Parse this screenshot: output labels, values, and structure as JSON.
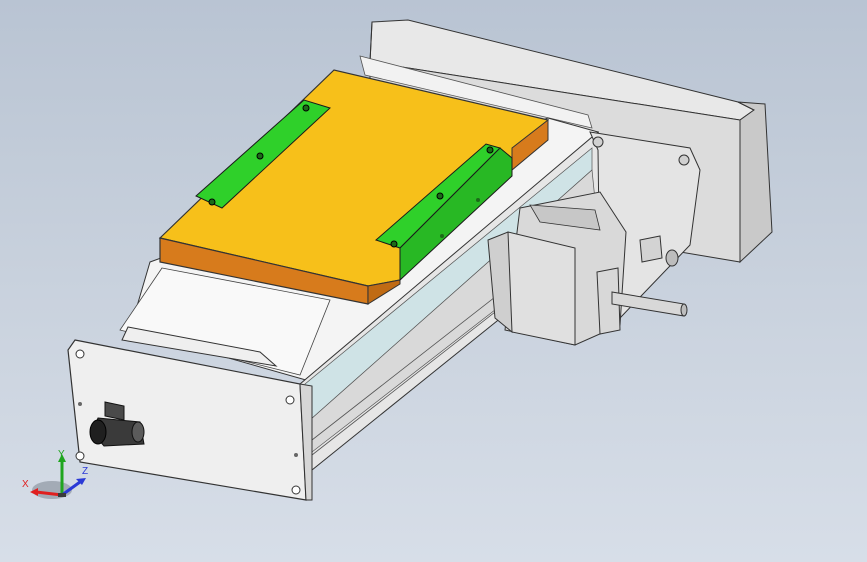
{
  "viewport": {
    "background_top": "#b9c4d3",
    "background_bottom": "#d7dee8"
  },
  "model": {
    "parts": {
      "carriage_plate": "#f7c01a",
      "carriage_plate_side": "#d77b1c",
      "brackets": "#2fd02a",
      "body": "#f1f1f1",
      "motor": "#e2e2e2",
      "fitting": "#3a3a3a"
    }
  },
  "triad": {
    "x_label": "X",
    "y_label": "Y",
    "z_label": "Z",
    "x_color": "#e01f1f",
    "y_color": "#1fa51f",
    "z_color": "#2a39d6",
    "icon": "coordinate-triad-icon"
  }
}
